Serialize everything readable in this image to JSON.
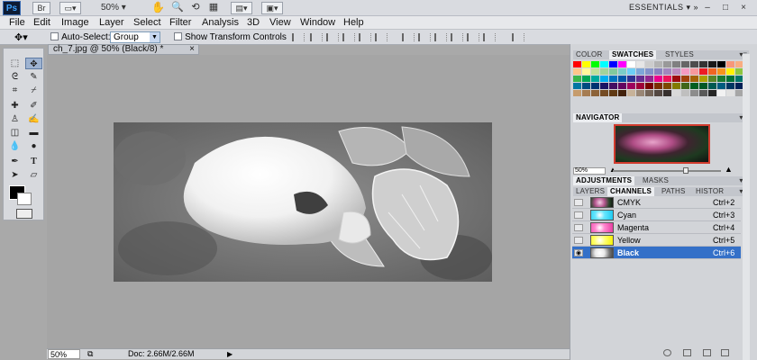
{
  "appbar": {
    "logo": "Ps",
    "zoom": "50%",
    "workspace": "ESSENTIALS",
    "window_controls": [
      "–",
      "□",
      "×"
    ]
  },
  "menu": [
    "File",
    "Edit",
    "Image",
    "Layer",
    "Select",
    "Filter",
    "Analysis",
    "3D",
    "View",
    "Window",
    "Help"
  ],
  "options": {
    "auto_select_label": "Auto-Select:",
    "auto_select_value": "Group",
    "show_transform_label": "Show Transform Controls"
  },
  "document": {
    "tab_title": "ch_7.jpg @ 50% (Black/8) *",
    "tab_close": "×",
    "zoom_status": "50%",
    "doc_info": "Doc: 2.66M/2.66M"
  },
  "panels": {
    "color_tabs": [
      "COLOR",
      "SWATCHES",
      "STYLES"
    ],
    "active_color_tab": "SWATCHES",
    "navigator_title": "NAVIGATOR",
    "navigator_zoom": "50%",
    "adjust_tabs": [
      "ADJUSTMENTS",
      "MASKS"
    ],
    "layer_tabs": [
      "LAYERS",
      "CHANNELS",
      "PATHS",
      "HISTOR"
    ],
    "active_layer_tab": "CHANNELS",
    "channels": [
      {
        "name": "CMYK",
        "key": "Ctrl+2",
        "visible": false,
        "active": false
      },
      {
        "name": "Cyan",
        "key": "Ctrl+3",
        "visible": false,
        "active": false
      },
      {
        "name": "Magenta",
        "key": "Ctrl+4",
        "visible": false,
        "active": false
      },
      {
        "name": "Yellow",
        "key": "Ctrl+5",
        "visible": false,
        "active": false
      },
      {
        "name": "Black",
        "key": "Ctrl+6",
        "visible": true,
        "active": true
      }
    ]
  },
  "colors": {
    "foreground": "#000000",
    "background": "#ffffff",
    "selection": "#3470c8"
  }
}
